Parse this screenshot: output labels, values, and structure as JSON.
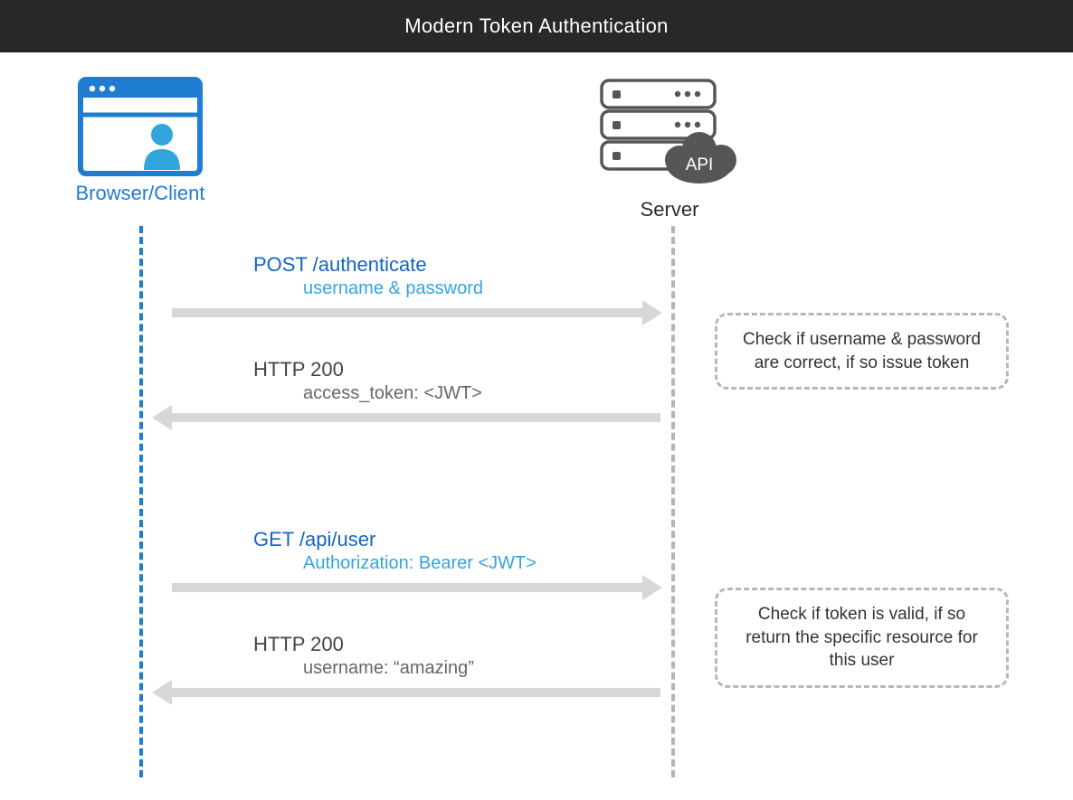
{
  "header": {
    "title": "Modern Token Authentication"
  },
  "participants": {
    "client": {
      "label": "Browser/Client"
    },
    "server": {
      "label": "Server",
      "api_badge": "API"
    }
  },
  "messages": {
    "auth_request": {
      "line1": "POST /authenticate",
      "line2": "username & password"
    },
    "auth_response": {
      "line1": "HTTP 200",
      "line2": "access_token: <JWT>"
    },
    "api_request": {
      "line1": "GET /api/user",
      "line2": "Authorization: Bearer <JWT>"
    },
    "api_response": {
      "line1": "HTTP 200",
      "line2": "username: “amazing”"
    }
  },
  "notes": {
    "auth": "Check if username & password are correct, if so issue token",
    "api": "Check if token is valid, if so return the specific resource for this user"
  }
}
